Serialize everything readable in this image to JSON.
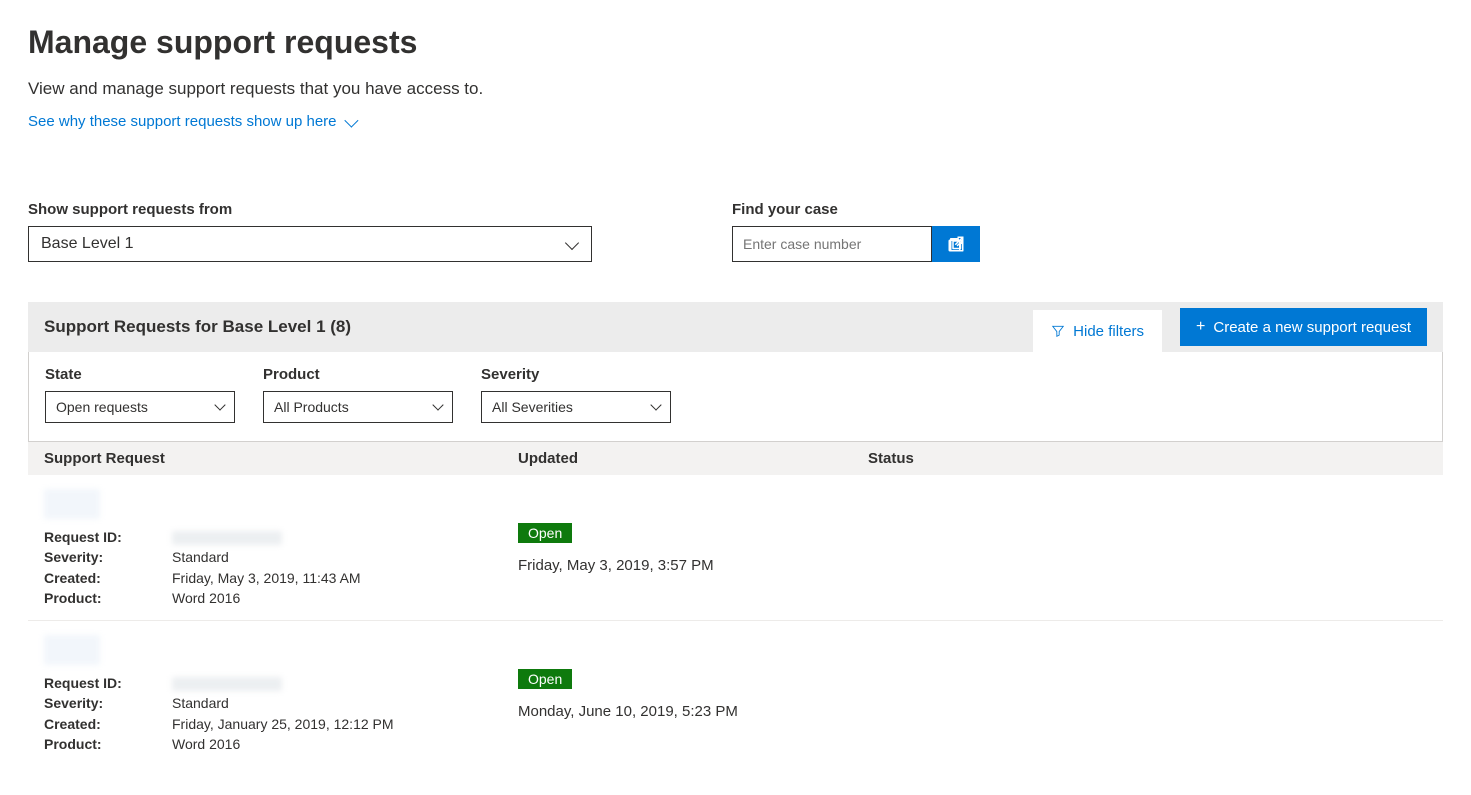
{
  "page": {
    "title": "Manage support requests",
    "subtitle": "View and manage support requests that you have access to.",
    "info_link": "See why these support requests show up here"
  },
  "controls": {
    "show_from_label": "Show support requests from",
    "show_from_value": "Base Level 1",
    "find_case_label": "Find your case",
    "find_case_placeholder": "Enter case number"
  },
  "panel": {
    "title": "Support Requests for Base Level 1 (8)",
    "hide_filters": "Hide filters",
    "create_new": "Create a new support request"
  },
  "filters": {
    "state_label": "State",
    "state_value": "Open requests",
    "product_label": "Product",
    "product_value": "All Products",
    "severity_label": "Severity",
    "severity_value": "All Severities"
  },
  "columns": {
    "request": "Support Request",
    "updated": "Updated",
    "status": "Status"
  },
  "field_labels": {
    "request_id": "Request ID:",
    "severity": "Severity:",
    "created": "Created:",
    "product": "Product:"
  },
  "rows": [
    {
      "severity": "Standard",
      "created": "Friday, May 3, 2019, 11:43 AM",
      "product": "Word 2016",
      "status_badge": "Open",
      "updated": "Friday, May 3, 2019, 3:57 PM"
    },
    {
      "severity": "Standard",
      "created": "Friday, January 25, 2019, 12:12 PM",
      "product": "Word 2016",
      "status_badge": "Open",
      "updated": "Monday, June 10, 2019, 5:23 PM"
    }
  ]
}
